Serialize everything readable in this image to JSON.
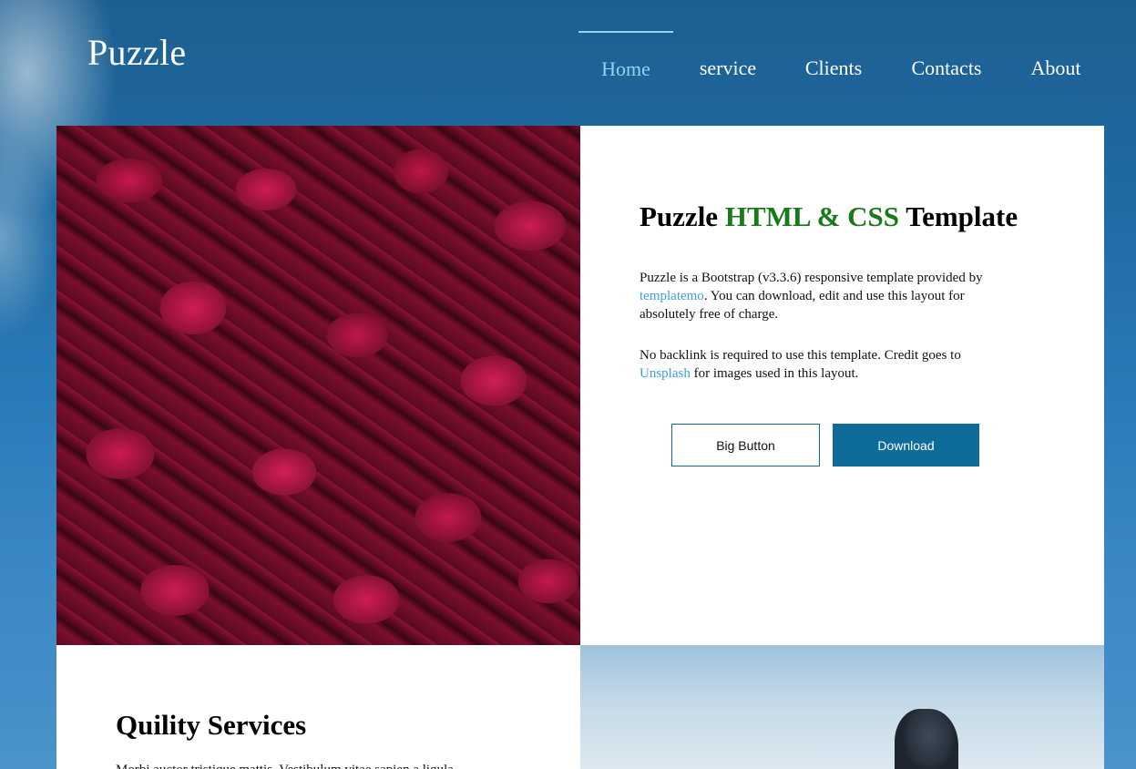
{
  "header": {
    "logo": "Puzzle",
    "nav": [
      {
        "label": "Home",
        "active": true
      },
      {
        "label": "service",
        "active": false
      },
      {
        "label": "Clients",
        "active": false
      },
      {
        "label": "Contacts",
        "active": false
      },
      {
        "label": "About",
        "active": false
      }
    ]
  },
  "hero": {
    "title_part1": "Puzzle ",
    "title_highlight": "HTML & CSS",
    "title_part2": " Template",
    "para1_before": "Puzzle is a Bootstrap (v3.3.6) responsive template provided by ",
    "para1_link": "templatemo",
    "para1_after": ". You can download, edit and use this layout for absolutely free of charge.",
    "para2_before": "No backlink is required to use this template. Credit goes to ",
    "para2_link": "Unsplash",
    "para2_after": " for images used in this layout.",
    "button_outline": "Big Button",
    "button_solid": "Download"
  },
  "services": {
    "title": "Quility Services",
    "text": "Morbi auctor tristique mattis. Vestibulum vitae sapien a ligula"
  },
  "colors": {
    "accent": "#0f6b9a",
    "nav_active": "#8fd6f0",
    "title_highlight": "#1a7a1a",
    "link": "#3aa0d8"
  }
}
